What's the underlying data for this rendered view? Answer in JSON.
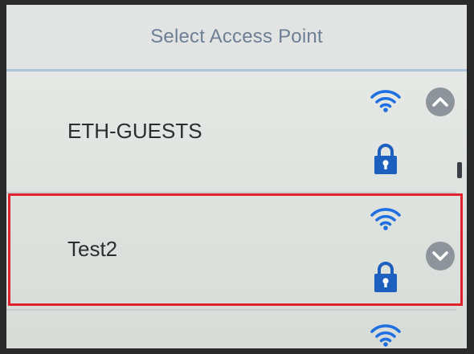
{
  "header": {
    "title": "Select Access Point"
  },
  "access_points": [
    {
      "ssid": "ETH-GUESTS",
      "wifi_icon": "wifi-icon",
      "lock_icon": "lock-icon",
      "selected": false
    },
    {
      "ssid": "Test2",
      "wifi_icon": "wifi-icon",
      "lock_icon": "lock-icon",
      "selected": true
    },
    {
      "ssid": "",
      "wifi_icon": "wifi-icon",
      "selected": false
    }
  ],
  "navigation": {
    "up_icon": "chevron-up-icon",
    "down_icon": "chevron-down-icon"
  },
  "colors": {
    "title": "#6e7f95",
    "wifi_blue": "#1f6fe0",
    "lock_blue": "#1d5fbf",
    "selection_red": "#e1222c",
    "nav_button": "#8e949c"
  }
}
